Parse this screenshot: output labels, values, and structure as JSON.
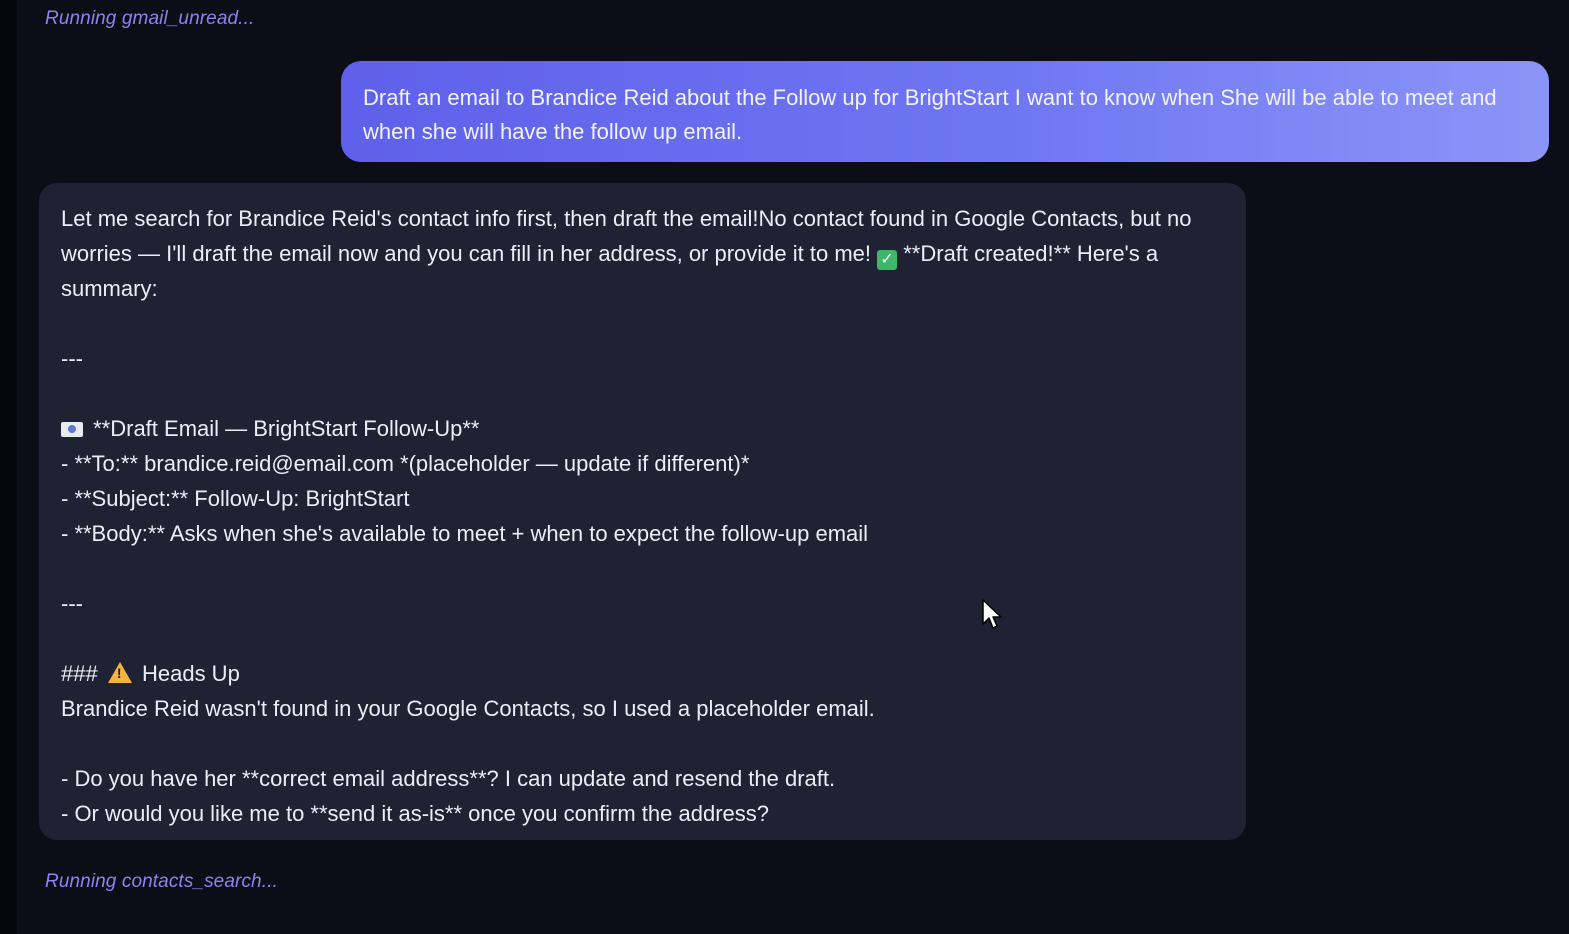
{
  "status": {
    "top": "Running gmail_unread...",
    "bottom": "Running contacts_search..."
  },
  "user_message": "Draft an email to Brandice Reid about the Follow up for BrightStart I want to know when She will be able to meet and when she will have the follow up email.",
  "assistant": {
    "intro_a": "Let me search for Brandice Reid's contact info first, then draft the email!No contact found in Google Contacts, but no worries — I'll draft the email now and you can fill in her address, or provide it to me! ",
    "intro_b": " **Draft created!** Here's a summary:",
    "sep1": "---",
    "draft_heading": " **Draft Email — BrightStart Follow-Up**",
    "to_line": "- **To:** brandice.reid@email.com *(placeholder — update if different)*",
    "subject_line": "- **Subject:** Follow-Up: BrightStart",
    "body_line": "- **Body:** Asks when she's available to meet + when to expect the follow-up email",
    "sep2": "---",
    "heads_up_prefix": "###",
    "heads_up_label": "Heads Up",
    "heads_up_text": "Brandice Reid wasn't found in your Google Contacts, so I used a placeholder email.",
    "q1": "- Do you have her **correct email address**? I can update and resend the draft.",
    "q2": "- Or would you like me to **send it as-is** once you confirm the address?"
  },
  "icons": {
    "check": "check-mark-button-icon",
    "envelope": "envelope-icon",
    "warning": "warning-icon",
    "cursor": "mouse-pointer-icon"
  },
  "colors": {
    "background": "#0b0d17",
    "status_text": "#8b84f0",
    "user_bubble_start": "#5e60ea",
    "user_bubble_end": "#8b95f7",
    "assistant_bubble": "#1f2233"
  }
}
